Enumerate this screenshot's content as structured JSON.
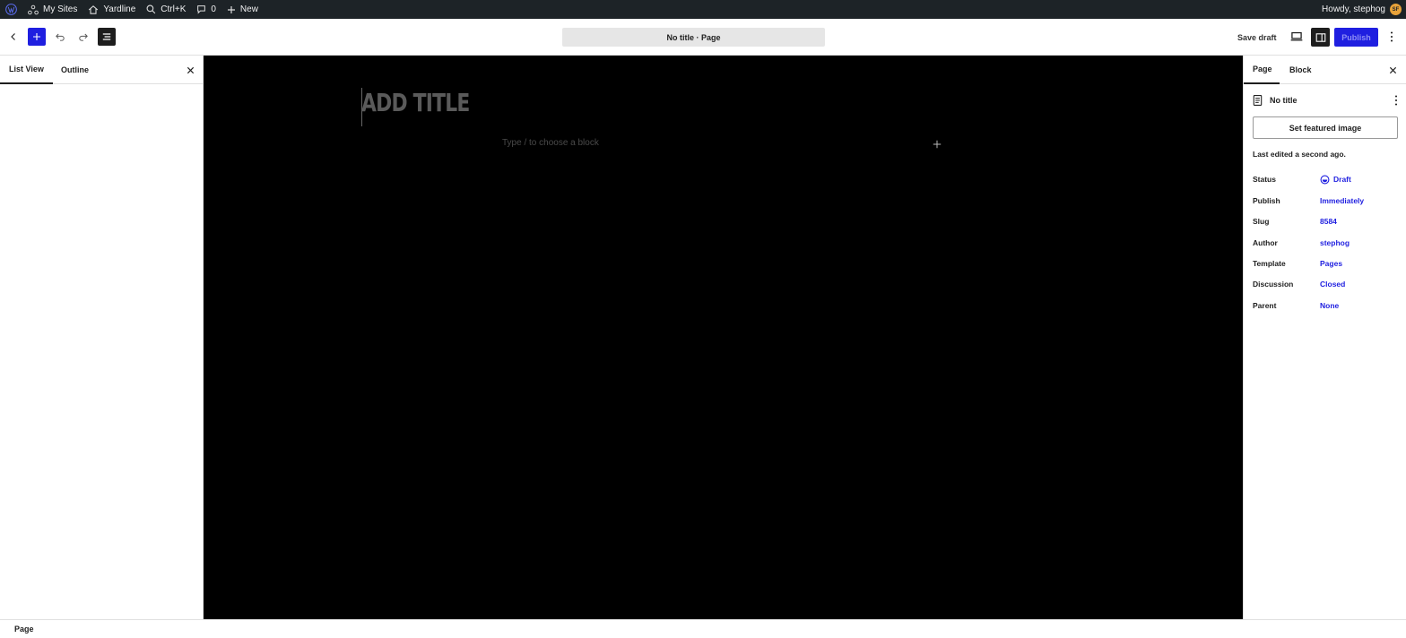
{
  "adminbar": {
    "my_sites": "My Sites",
    "site_name": "Yardline",
    "search_shortcut": "Ctrl+K",
    "comments_count": "0",
    "new_label": "New",
    "howdy": "Howdy, stephog",
    "avatar_initials": "SF"
  },
  "header": {
    "document_title": "No title · Page",
    "save_draft": "Save draft",
    "publish": "Publish"
  },
  "left_panel": {
    "tabs": [
      "List View",
      "Outline"
    ]
  },
  "canvas": {
    "title_placeholder": "ADD TITLE",
    "block_placeholder": "Type / to choose a block"
  },
  "sidebar": {
    "tabs": [
      "Page",
      "Block"
    ],
    "doc_title": "No title",
    "featured_image": "Set featured image",
    "last_edited": "Last edited a second ago.",
    "properties": [
      {
        "label": "Status",
        "value": "Draft"
      },
      {
        "label": "Publish",
        "value": "Immediately"
      },
      {
        "label": "Slug",
        "value": "8584"
      },
      {
        "label": "Author",
        "value": "stephog"
      },
      {
        "label": "Template",
        "value": "Pages"
      },
      {
        "label": "Discussion",
        "value": "Closed"
      },
      {
        "label": "Parent",
        "value": "None"
      }
    ]
  },
  "footer": {
    "breadcrumb": "Page"
  },
  "colors": {
    "accent": "#1f1fe0",
    "adminbar": "#1d2327",
    "canvas": "#000000"
  }
}
